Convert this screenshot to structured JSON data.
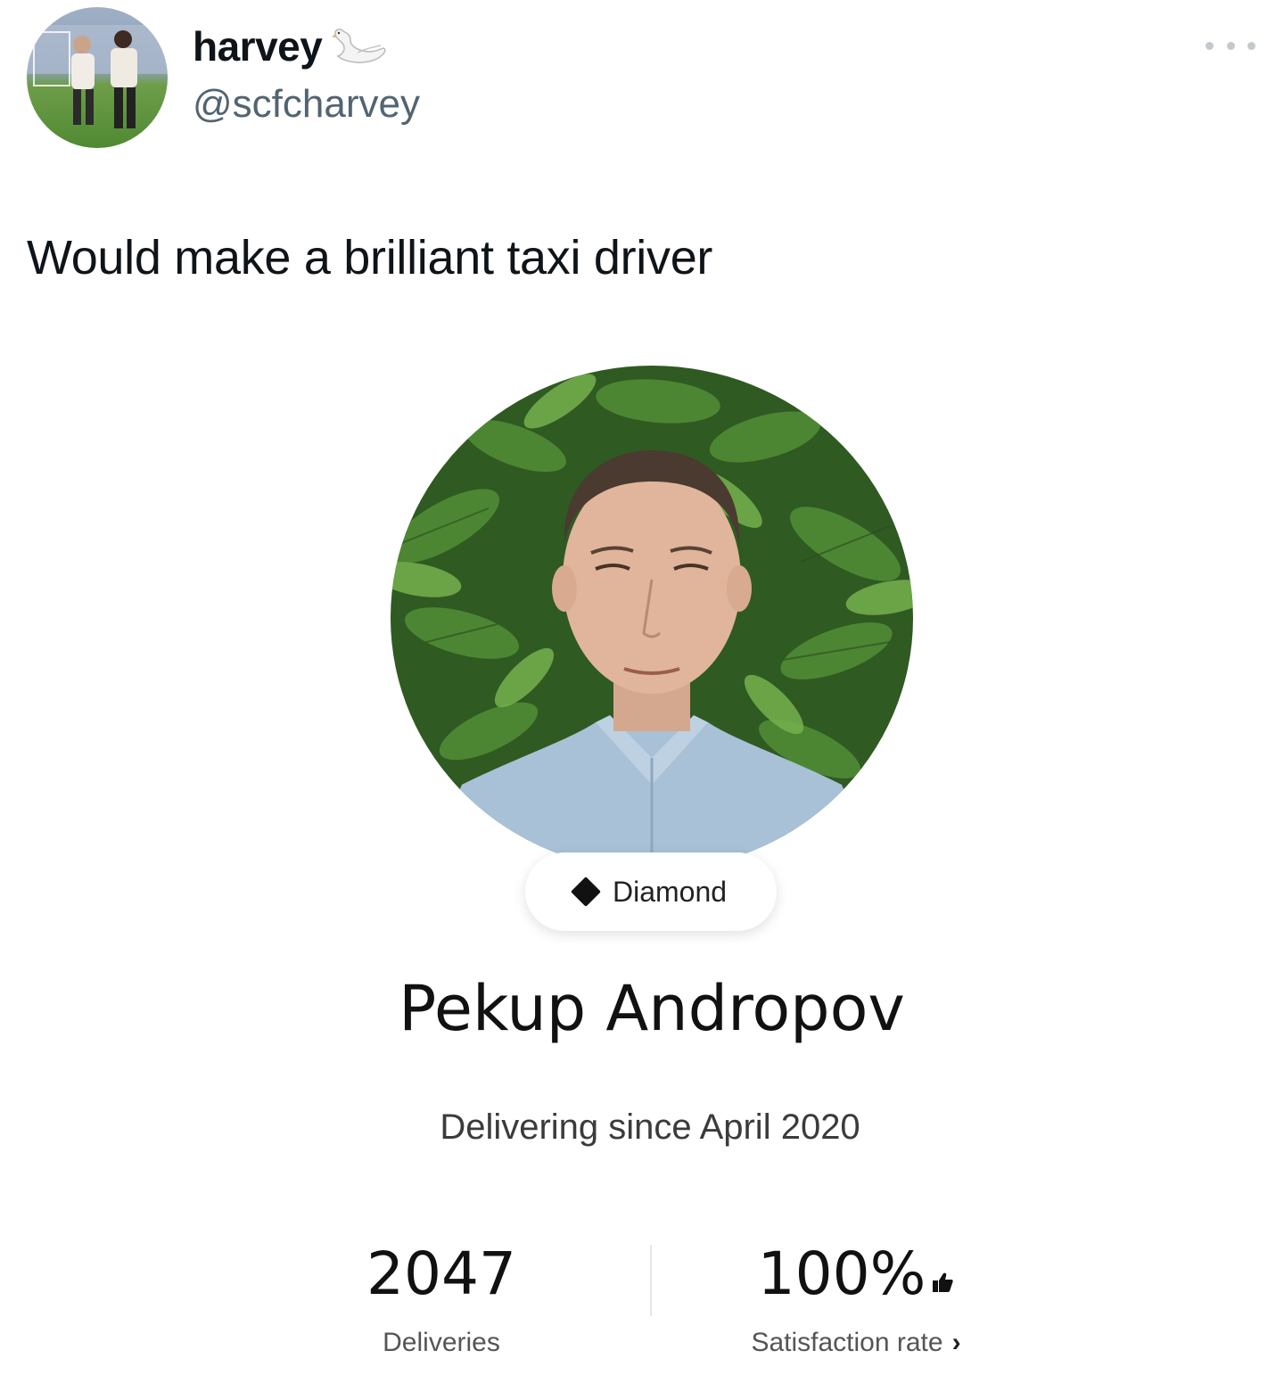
{
  "tweet": {
    "author": {
      "display_name": "harvey",
      "handle": "@scfcharvey",
      "name_emoji_icon": "swan-icon",
      "avatar": "football-players-photo"
    },
    "more_icon": "more-dots-icon",
    "text": "Would make a brilliant taxi driver"
  },
  "profile_card": {
    "photo": "man-in-front-of-leaves-photo",
    "tier": {
      "icon": "diamond-icon",
      "label": "Diamond"
    },
    "name": "Pekup Andropov",
    "since": "Delivering since April 2020",
    "stats": {
      "deliveries": {
        "value": "2047",
        "label": "Deliveries"
      },
      "satisfaction": {
        "value": "100%",
        "value_icon": "thumbs-up-icon",
        "label": "Satisfaction rate",
        "label_icon": "chevron-right-icon"
      }
    }
  },
  "colors": {
    "text_primary": "#0f1419",
    "text_secondary": "#536471",
    "divider": "#e6e6e6"
  }
}
